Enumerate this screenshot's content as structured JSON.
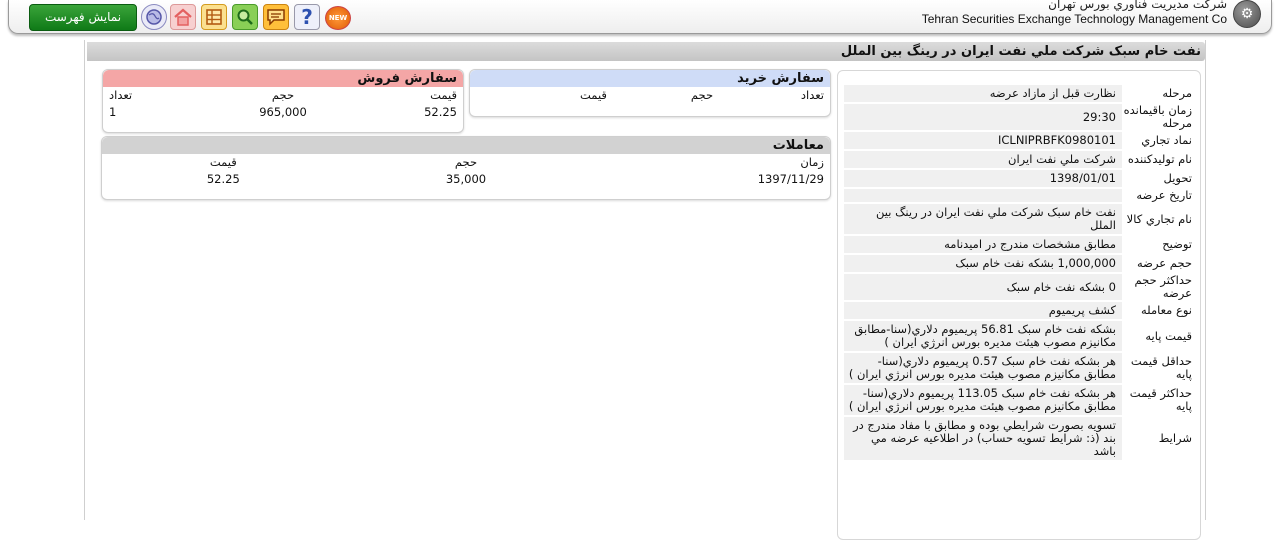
{
  "header": {
    "company_fa": "شرکت مديريت فناوري بورس تهران",
    "company_en": "Tehran Securities Exchange Technology Management Co",
    "show_list_label": "نمايش فهرست",
    "new_badge": "NEW",
    "help_glyph": "?",
    "icons": [
      "globe-icon",
      "home-icon",
      "table-icon",
      "search-icon",
      "chat-icon",
      "help-icon",
      "new-badge-icon"
    ]
  },
  "page_title": "نفت خام سبک شرکت ملي نفت ايران در رينگ بين الملل",
  "info": [
    {
      "label": "مرحله",
      "value": "نظارت قبل از مازاد عرضه"
    },
    {
      "label": "زمان باقيمانده مرحله",
      "value": "29:30"
    },
    {
      "label": "نماد تجاري",
      "value": "ICLNIPRBFK0980101"
    },
    {
      "label": "نام توليدکننده",
      "value": "شرکت ملي نفت ايران"
    },
    {
      "label": "تحويل",
      "value": "1398/01/01"
    },
    {
      "label": "تاريخ عرضه",
      "value": ""
    },
    {
      "label": "نام تجاري کالا",
      "value": "نفت خام سبک شرکت ملي نفت ايران در رينگ بين الملل"
    },
    {
      "label": "توضيح",
      "value": "مطابق مشخصات مندرج در اميدنامه"
    },
    {
      "label": "حجم عرضه",
      "value": "1,000,000 بشکه نفت خام سبک"
    },
    {
      "label": "حداکثر حجم عرضه",
      "value": "0 بشکه نفت خام سبک"
    },
    {
      "label": "نوع معامله",
      "value": "کشف پريميوم"
    },
    {
      "label": "قيمت پايه",
      "value": "بشکه نفت خام سبک 56.81 پريميوم دلاري(سنا-مطابق مکانيزم مصوب هيئت مديره بورس انرژي ايران )"
    },
    {
      "label": "حداقل قيمت پايه",
      "value": "هر بشکه نفت خام سبک 0.57 پريميوم دلاري(سنا-مطابق مکانيزم مصوب هيئت مديره بورس انرژي ايران )"
    },
    {
      "label": "حداکثر قيمت پايه",
      "value": "هر بشکه نفت خام سبک 113.05 پريميوم دلاري(سنا-مطابق مکانيزم مصوب هيئت مديره بورس انرژي ايران )"
    },
    {
      "label": "شرايط",
      "value": "تسويه بصورت شرايطي بوده و مطابق با مفاد مندرج در بند (ذ: شرايط تسويه حساب) در اطلاعيه عرضه مي باشد"
    }
  ],
  "buy_orders": {
    "title": "سفارش خريد",
    "columns": [
      "تعداد",
      "حجم",
      "قيمت"
    ],
    "rows": []
  },
  "sell_orders": {
    "title": "سفارش فروش",
    "columns": [
      "قيمت",
      "حجم",
      "تعداد"
    ],
    "rows": [
      [
        "52.25",
        "965,000",
        "1"
      ]
    ]
  },
  "trades": {
    "title": "معاملات",
    "columns": [
      "زمان",
      "حجم",
      "قيمت"
    ],
    "rows": [
      [
        "1397/11/29",
        "35,000",
        "52.25"
      ]
    ]
  }
}
